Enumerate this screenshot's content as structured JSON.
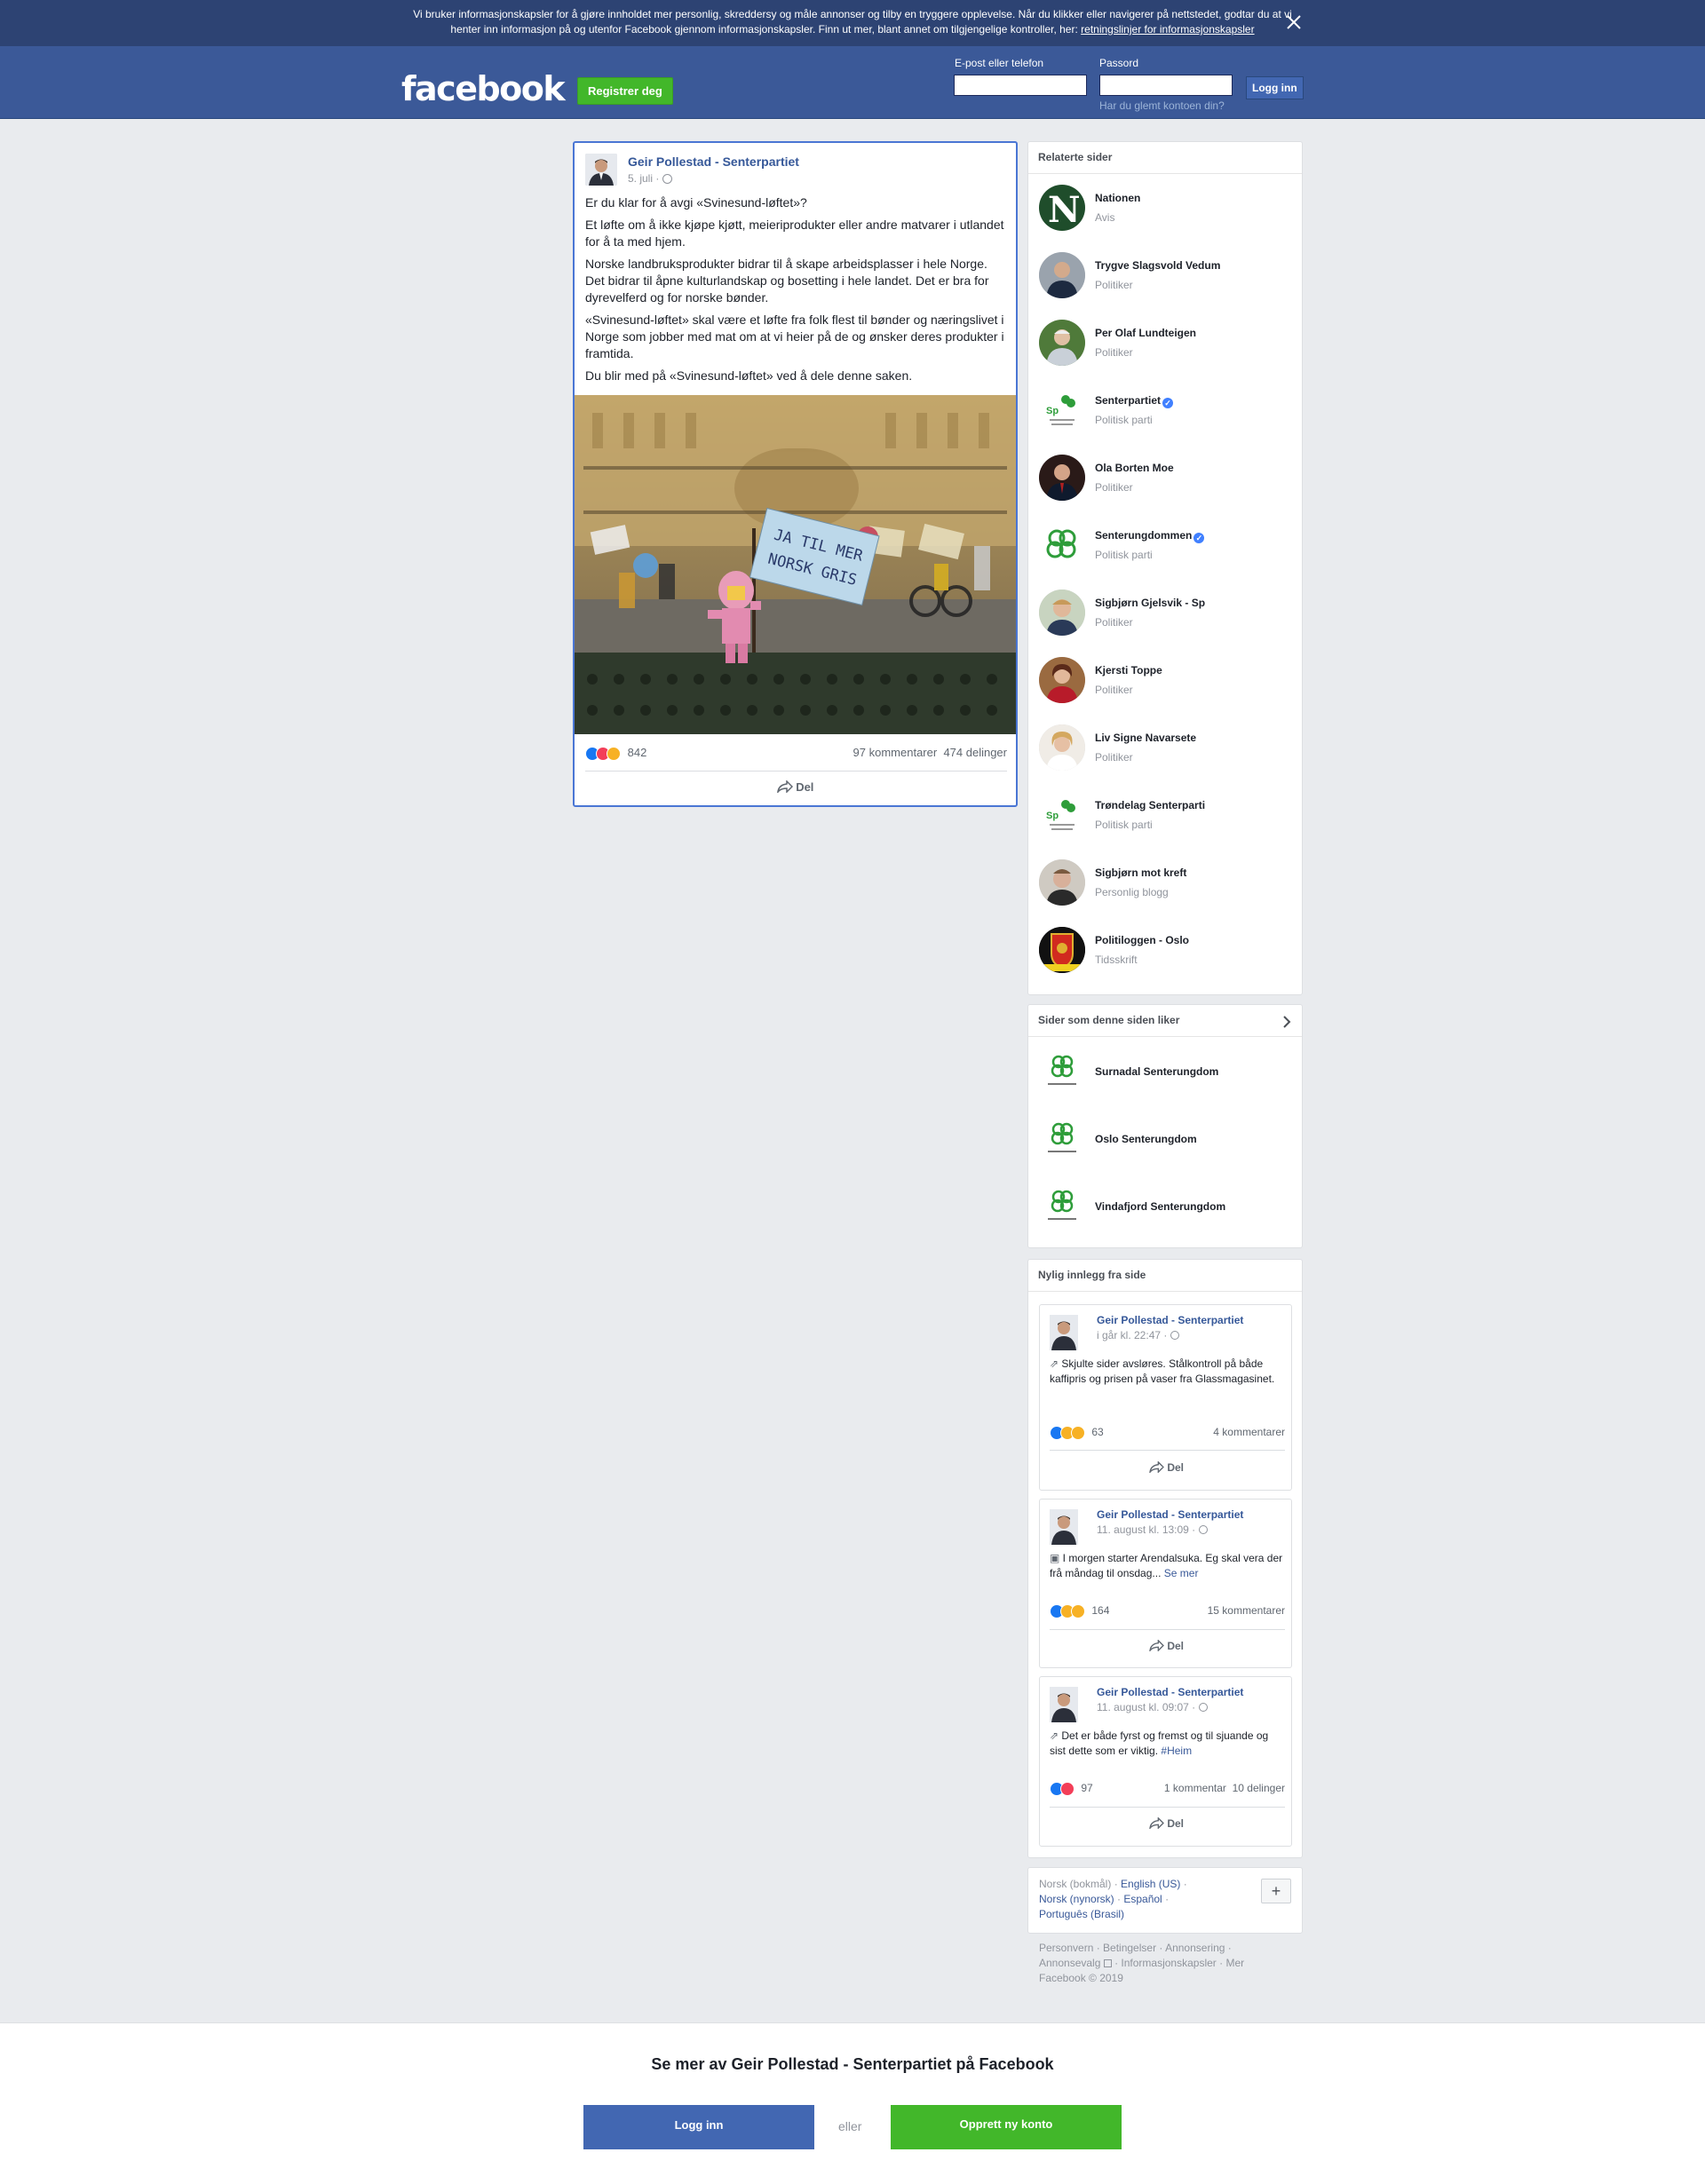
{
  "cookie_banner": {
    "text": "Vi bruker informasjonskapsler for å gjøre innholdet mer personlig, skreddersy og måle annonser og tilby en tryggere opplevelse. Når du klikker eller navigerer på nettstedet, godtar du at vi henter inn informasjon på og utenfor Facebook gjennom informasjonskapsler. Finn ut mer, blant annet om tilgjengelige kontroller, her: ",
    "link": "retningslinjer for informasjonskapsler"
  },
  "header": {
    "logo": "facebook",
    "register_label": "Registrer deg",
    "email_label": "E-post eller telefon",
    "password_label": "Passord",
    "login_label": "Logg inn",
    "forgot_label": "Har du glemt kontoen din?"
  },
  "post": {
    "author": "Geir Pollestad - Senterpartiet",
    "date": "5. juli ·",
    "paragraphs": [
      "Er du klar for å avgi «Svinesund-løftet»?",
      "Et løfte om å ikke kjøpe kjøtt, meieriprodukter eller andre matvarer i utlandet for å ta med hjem.",
      "Norske landbruksprodukter bidrar til å skape arbeidsplasser i hele Norge. Det bidrar til åpne kulturlandskap og bosetting i hele landet. Det er bra for dyrevelferd og for norske bønder.",
      "«Svinesund-løftet» skal være et løfte fra folk flest til bønder og næringslivet i Norge som jobber med mat om at vi heier på de og ønsker deres produkter i framtida.",
      "Du blir med på «Svinesund-løftet» ved å dele denne saken."
    ],
    "sign_text_1": "JA TIL MER",
    "sign_text_2": "NORSK GRIS",
    "reactions_count": "842",
    "comments": "97 kommentarer",
    "shares": "474 delinger",
    "share_label": "Del"
  },
  "related": {
    "title": "Relaterte sider",
    "items": [
      {
        "name": "Nationen",
        "category": "Avis"
      },
      {
        "name": "Trygve Slagsvold Vedum",
        "category": "Politiker"
      },
      {
        "name": "Per Olaf Lundteigen",
        "category": "Politiker"
      },
      {
        "name": "Senterpartiet",
        "category": "Politisk parti"
      },
      {
        "name": "Ola Borten Moe",
        "category": "Politiker"
      },
      {
        "name": "Senterungdommen",
        "category": "Politisk parti"
      },
      {
        "name": "Sigbjørn Gjelsvik - Sp",
        "category": "Politiker"
      },
      {
        "name": "Kjersti Toppe",
        "category": "Politiker"
      },
      {
        "name": "Liv Signe Navarsete",
        "category": "Politiker"
      },
      {
        "name": "Trøndelag Senterparti",
        "category": "Politisk parti"
      },
      {
        "name": "Sigbjørn mot kreft",
        "category": "Personlig blogg"
      },
      {
        "name": "Politiloggen - Oslo",
        "category": "Tidsskrift"
      }
    ]
  },
  "liked_pages": {
    "title": "Sider som denne siden liker",
    "items": [
      {
        "name": "Surnadal Senterungdom"
      },
      {
        "name": "Oslo Senterungdom"
      },
      {
        "name": "Vindafjord Senterungdom"
      }
    ]
  },
  "recent": {
    "title": "Nylig innlegg fra side",
    "posts": [
      {
        "author": "Geir Pollestad - Senterpartiet",
        "date": "i går kl. 22:47 ·",
        "text": "Skjulte sider avsløres. Stålkontroll på både kaffipris og prisen på vaser fra Glassmagasinet.",
        "tag": "",
        "count": "63",
        "comments": "4 kommentarer",
        "shares": "",
        "share_label": "Del"
      },
      {
        "author": "Geir Pollestad - Senterpartiet",
        "date": "11. august kl. 13:09 ·",
        "text": "I morgen starter Arendalsuka. Eg skal vera der frå måndag til onsdag...",
        "tag": "Se mer",
        "count": "164",
        "comments": "15 kommentarer",
        "shares": "",
        "share_label": "Del"
      },
      {
        "author": "Geir Pollestad - Senterpartiet",
        "date": "11. august kl. 09:07 ·",
        "text": "Det er både fyrst og fremst og til sjuande og sist dette som er viktig.",
        "tag": "#Heim",
        "count": "97",
        "comments": "1 kommentar",
        "shares": "10 delinger",
        "share_label": "Del"
      }
    ]
  },
  "languages": {
    "current": "Norsk (bokmål)",
    "others": [
      "English (US)",
      "Norsk (nynorsk)",
      "Español",
      "Português (Brasil)"
    ],
    "add_label": "+"
  },
  "footer": {
    "links": "Personvern · Betingelser · Annonsering · Annonsevalg",
    "links2": " · Informasjonskapsler · Mer",
    "copyright": "Facebook © 2019"
  },
  "bottom_bar": {
    "title": "Se mer av Geir Pollestad - Senterpartiet på Facebook",
    "login_label": "Logg inn",
    "or_label": "eller",
    "create_label": "Opprett ny konto"
  },
  "colors": {
    "brand_blue": "#3b5998",
    "link_blue": "#365899",
    "green": "#42b72a"
  }
}
